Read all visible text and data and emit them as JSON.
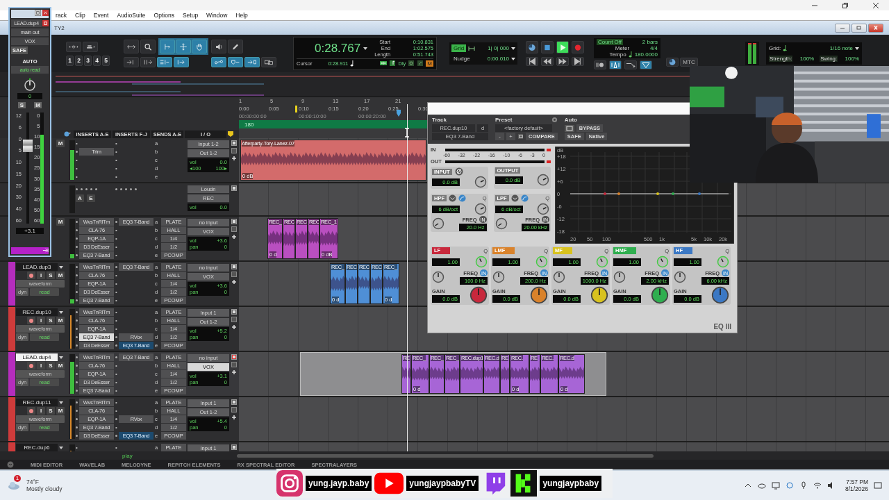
{
  "window": {
    "title_fragment": "TY2"
  },
  "menu": [
    "rack",
    "Clip",
    "Event",
    "AudioSuite",
    "Options",
    "Setup",
    "Window",
    "Help"
  ],
  "toolbar": {
    "zoom_presets": [
      "1",
      "2",
      "3",
      "4",
      "5"
    ],
    "counter": "0:28.767",
    "range_labels": [
      "Start",
      "End",
      "Length"
    ],
    "range_values": [
      "0:10.831",
      "1:02.575",
      "0:51.743"
    ],
    "cursor_label": "Cursor",
    "cursor_value": "0:28.911",
    "dly": "Dly",
    "m": "M",
    "grid_label": "Grid",
    "nudge_label": "Nudge",
    "grid_value": "1| 0| 000",
    "nudge_value": "0:00.010",
    "playing": true,
    "count_off": "Count Off",
    "bars": "2 bars",
    "meter_label": "Meter",
    "meter": "4/4",
    "tempo_label": "Tempo",
    "tempo": "180.0000",
    "mtc": "MTC",
    "grid2_label": "Grid:",
    "grid2_value": "1/16 note",
    "strength_label": "Strength:",
    "strength": "100%",
    "swing_label": "Swing:",
    "swing": "100%"
  },
  "ruler": {
    "bars": [
      "1",
      "5",
      "9",
      "13",
      "17",
      "21"
    ],
    "times": [
      "0:00",
      "0:05",
      "0:10",
      "0:15",
      "0:20",
      "0:25",
      "0:30"
    ],
    "timecodes": [
      "00:00:00:00",
      "00:00:10:00",
      "00:00:20:00"
    ],
    "tempo": "180"
  },
  "columns": [
    "INSERTS A-E",
    "INSERTS F-J",
    "SENDS A-E",
    "I / O"
  ],
  "tracks": [
    {
      "kind": "audio",
      "buttons": [
        "M"
      ],
      "level": 0.75,
      "inserts_a": [
        {
          "kind": "empty",
          "mark": "•"
        },
        {
          "kind": "plugin",
          "name": "Trim"
        },
        {
          "kind": "empty",
          "mark": "•"
        },
        {
          "kind": "empty",
          "mark": "•"
        },
        {
          "kind": "empty",
          "mark": "•"
        }
      ],
      "inserts_f": [
        {
          "kind": "empty",
          "mark": "•"
        },
        {
          "kind": "empty",
          "mark": "•"
        },
        {
          "kind": "empty",
          "mark": "•"
        },
        {
          "kind": "empty",
          "mark": "•"
        },
        {
          "kind": "empty",
          "mark": "•"
        }
      ],
      "sends": [
        {
          "letter": "a"
        },
        {
          "letter": "b"
        },
        {
          "letter": "c"
        },
        {
          "letter": "d"
        },
        {
          "letter": "e"
        }
      ],
      "input": "Input 1-2",
      "output": "Out 1-2",
      "vol_label": "vol",
      "vol": "0.0",
      "pan_left": "◂100",
      "pan_right": "100▸",
      "clips": [
        {
          "label": "Afterparty-Tory-Lanez-07",
          "gain": "0 dB",
          "color": "#d36b6b"
        }
      ]
    },
    {
      "kind": "aux",
      "buttons": [
        "A",
        "E"
      ],
      "input": "Loudn",
      "output": "REC",
      "vol_label": "vol",
      "vol": "0.0"
    },
    {
      "kind": "audio",
      "buttons": [
        "M"
      ],
      "level": 0.1,
      "inserts_a": [
        {
          "kind": "plugin",
          "name": "WvsTnRlTm"
        },
        {
          "kind": "plugin",
          "name": "CLA-76"
        },
        {
          "kind": "plugin",
          "name": "EQP-1A"
        },
        {
          "kind": "plugin",
          "name": "D3 DeEsser"
        },
        {
          "kind": "plugin",
          "name": "EQ3 7-Band"
        }
      ],
      "inserts_f": [
        {
          "kind": "plugin",
          "name": "EQ3 7-Band"
        },
        {
          "kind": "empty",
          "mark": "•"
        },
        {
          "kind": "empty",
          "mark": "•"
        },
        {
          "kind": "empty",
          "mark": "•"
        },
        {
          "kind": "empty",
          "mark": "•"
        }
      ],
      "sends": [
        {
          "letter": "a",
          "name": "PLATE"
        },
        {
          "letter": "b",
          "name": "HALL"
        },
        {
          "letter": "c",
          "name": "1/4"
        },
        {
          "letter": "d",
          "name": "1/2"
        },
        {
          "letter": "e",
          "name": "PCOMP"
        }
      ],
      "input": "no input",
      "output": "VOX",
      "vol_label": "vol",
      "vol": "+3.6",
      "pan_label": "pan",
      "pan": "0",
      "clips": [
        {
          "label": "REC_",
          "gain": "0 d",
          "color": "#b94fc0"
        },
        {
          "label": "REC",
          "color": "#b94fc0"
        },
        {
          "label": "REC",
          "color": "#b94fc0"
        },
        {
          "label": "REC",
          "color": "#b94fc0"
        },
        {
          "label": "REC_1",
          "gain": "0 dB",
          "color": "#b94fc0"
        }
      ]
    },
    {
      "kind": "audio",
      "name": "LEAD.dup3",
      "color": "#b52dbd",
      "selected": false,
      "buttons": [
        "I",
        "S",
        "M"
      ],
      "armable": true,
      "view": "waveform",
      "dyn": "dyn",
      "auto": "read",
      "level": 0.1,
      "inserts_a": [
        {
          "kind": "plugin",
          "name": "WvsTnRlTm"
        },
        {
          "kind": "plugin",
          "name": "CLA-76"
        },
        {
          "kind": "plugin",
          "name": "EQP-1A"
        },
        {
          "kind": "plugin",
          "name": "D3 DeEsser"
        },
        {
          "kind": "plugin",
          "name": "EQ3 7-Band"
        }
      ],
      "inserts_f": [
        {
          "kind": "plugin",
          "name": "EQ3 7-Band"
        },
        {
          "kind": "empty",
          "mark": "•"
        },
        {
          "kind": "empty",
          "mark": "•"
        },
        {
          "kind": "empty",
          "mark": "•"
        },
        {
          "kind": "empty",
          "mark": "•"
        }
      ],
      "sends": [
        {
          "letter": "a",
          "name": "PLATE"
        },
        {
          "letter": "b",
          "name": "HALL"
        },
        {
          "letter": "c",
          "name": "1/4"
        },
        {
          "letter": "d",
          "name": "1/2"
        },
        {
          "letter": "e",
          "name": "PCOMP"
        }
      ],
      "input": "no input",
      "output": "VOX",
      "vol_label": "vol",
      "vol": "+3.6",
      "pan_label": "pan",
      "pan": "0",
      "clips": [
        {
          "label": "REC_",
          "gain": "0 d",
          "color": "#4f8fd6"
        },
        {
          "label": "REC",
          "color": "#4f8fd6"
        },
        {
          "label": "REC",
          "color": "#4f8fd6"
        },
        {
          "label": "REC",
          "color": "#4f8fd6"
        },
        {
          "label": "REC_",
          "gain": "0 d",
          "color": "#4f8fd6"
        }
      ]
    },
    {
      "kind": "audio",
      "name": "REC.dup10",
      "color": "#cf3b3b",
      "selected": false,
      "buttons": [
        "I",
        "S",
        "M"
      ],
      "armable": true,
      "view": "waveform",
      "dyn": "dyn",
      "auto": "read",
      "level": 0.85,
      "inserts_a": [
        {
          "kind": "plugin",
          "name": "WvsTnRlTm"
        },
        {
          "kind": "plugin",
          "name": "CLA-76"
        },
        {
          "kind": "plugin",
          "name": "EQP-1A"
        },
        {
          "kind": "open",
          "name": "EQ3 7-Band"
        },
        {
          "kind": "plugin",
          "name": "D3 DeEsser"
        }
      ],
      "inserts_f": [
        {
          "kind": "empty",
          "mark": "•"
        },
        {
          "kind": "empty",
          "mark": "•"
        },
        {
          "kind": "empty",
          "mark": "•"
        },
        {
          "kind": "plugin",
          "name": "RVox"
        },
        {
          "kind": "active",
          "name": "EQ3 7-Band"
        }
      ],
      "sends": [
        {
          "letter": "a",
          "name": "PLATE"
        },
        {
          "letter": "b",
          "name": "HALL"
        },
        {
          "letter": "c",
          "name": "1/4"
        },
        {
          "letter": "d",
          "name": "1/2"
        },
        {
          "letter": "e",
          "name": "PCOMP"
        }
      ],
      "input": "Input 1",
      "output": "Out 1-2",
      "vol_label": "vol",
      "vol": "+5.2",
      "pan_label": "pan",
      "pan": "0"
    },
    {
      "kind": "audio",
      "name": "LEAD.dup4",
      "color": "#b52dbd",
      "selected": true,
      "buttons": [
        "I",
        "S",
        "M"
      ],
      "armable": true,
      "view": "waveform",
      "dyn": "dyn",
      "auto": "read",
      "level": 0.8,
      "inserts_a": [
        {
          "kind": "plugin",
          "name": "WvsTnRlTm"
        },
        {
          "kind": "plugin",
          "name": "CLA-76"
        },
        {
          "kind": "plugin",
          "name": "EQP-1A"
        },
        {
          "kind": "plugin",
          "name": "D3 DeEsser"
        },
        {
          "kind": "plugin",
          "name": "EQ3 7-Band"
        }
      ],
      "inserts_f": [
        {
          "kind": "plugin",
          "name": "EQ3 7-Band"
        },
        {
          "kind": "empty",
          "mark": "•"
        },
        {
          "kind": "empty",
          "mark": "•"
        },
        {
          "kind": "empty",
          "mark": "•"
        },
        {
          "kind": "empty",
          "mark": "•"
        }
      ],
      "sends": [
        {
          "letter": "a",
          "name": "PLATE"
        },
        {
          "letter": "b",
          "name": "HALL"
        },
        {
          "letter": "c",
          "name": "1/4"
        },
        {
          "letter": "d",
          "name": "1/2"
        },
        {
          "letter": "e",
          "name": "PCOMP"
        }
      ],
      "input": "no input",
      "output": "VOX",
      "vol_label": "vol",
      "vol": "+3.1",
      "pan_label": "pan",
      "pan": "0",
      "selection": true,
      "clips": [
        {
          "label": "RE",
          "color": "#a765d6"
        },
        {
          "label": "REC_",
          "gain": "0 d",
          "color": "#a765d6"
        },
        {
          "label": "REC_",
          "color": "#a765d6"
        },
        {
          "label": "REC_",
          "color": "#a765d6"
        },
        {
          "label": "REC.dup1",
          "color": "#a765d6"
        },
        {
          "label": "REC.d",
          "color": "#a765d6"
        },
        {
          "label": "RE",
          "color": "#a765d6"
        },
        {
          "label": "REC.",
          "gain": "0 d",
          "color": "#a765d6"
        },
        {
          "label": "RE",
          "color": "#a765d6"
        },
        {
          "label": "REC.",
          "color": "#a765d6"
        },
        {
          "label": "REC.d",
          "gain": "0 d",
          "color": "#a765d6"
        }
      ]
    },
    {
      "kind": "audio",
      "name": "REC.dup11",
      "color": "#cf3b3b",
      "selected": false,
      "buttons": [
        "I",
        "S",
        "M"
      ],
      "armable": true,
      "view": "waveform",
      "dyn": "dyn",
      "auto": "read",
      "level": 0.85,
      "inserts_a": [
        {
          "kind": "plugin",
          "name": "WvsTnRlTm"
        },
        {
          "kind": "plugin",
          "name": "CLA-76"
        },
        {
          "kind": "plugin",
          "name": "EQP-1A"
        },
        {
          "kind": "plugin",
          "name": "EQ3 7-Band"
        },
        {
          "kind": "plugin",
          "name": "D3 DeEsser"
        }
      ],
      "inserts_f": [
        {
          "kind": "empty",
          "mark": "•"
        },
        {
          "kind": "empty",
          "mark": "•"
        },
        {
          "kind": "plugin",
          "name": "RVox"
        },
        {
          "kind": "empty",
          "mark": "•"
        },
        {
          "kind": "active",
          "name": "EQ3 7-Band"
        }
      ],
      "sends": [
        {
          "letter": "a",
          "name": "PLATE"
        },
        {
          "letter": "b",
          "name": "HALL"
        },
        {
          "letter": "c",
          "name": "1/4"
        },
        {
          "letter": "d",
          "name": "1/2"
        },
        {
          "letter": "e",
          "name": "PCOMP"
        }
      ],
      "input": "Input 1",
      "output": "Out 1-2",
      "vol_label": "vol",
      "vol": "+5.4",
      "pan_label": "pan",
      "pan": "0"
    },
    {
      "kind": "audio",
      "name": "REC.dup6",
      "color": "#cf3b3b",
      "selected": false,
      "level": 0.85,
      "inserts_a": [
        {
          "kind": "empty",
          "mark": "•"
        }
      ],
      "inserts_f": [
        {
          "kind": "empty",
          "mark": "•"
        }
      ],
      "sends": [
        {
          "letter": "a",
          "name": "PLATE"
        }
      ],
      "input": "Input 1"
    }
  ],
  "footer": {
    "mode": "play",
    "tabs": [
      "MIDI EDITOR",
      "WAVELAB",
      "MELODYNE",
      "REPITCH ELEMENTS",
      "RX SPECTRAL EDITOR",
      "SPECTRALAYERS"
    ]
  },
  "strip": {
    "name": "LEAD.dup4",
    "output": "main out",
    "group": "VOX",
    "safe": "SAFE",
    "auto_label": "AUTO",
    "auto": "auto read",
    "pan": "0",
    "solo": "S",
    "mute": "M",
    "scale": [
      "12",
      "6",
      "0",
      "5",
      "10",
      "15",
      "20",
      "30",
      "40",
      "60"
    ],
    "meter_scale": [
      "0",
      "5",
      "10",
      "15",
      "20",
      "25",
      "30",
      "35",
      "40",
      "50",
      "60"
    ],
    "level": 0.7,
    "meter": {
      "level": 0.8
    },
    "volume": "+3.1"
  },
  "plugin": {
    "track_label": "Track",
    "preset_label": "Preset",
    "auto_label": "Auto",
    "track": "REC.dup10",
    "channel": "d",
    "preset": "<factory default>",
    "plugin": "EQ3 7-Band",
    "minus": "-",
    "plus": "+",
    "compare": "COMPARE",
    "safe": "SAFE",
    "bypass": "BYPASS",
    "native": "Native",
    "in": "IN",
    "out": "OUT",
    "meter_scale": [
      "-60",
      "-32",
      "-22",
      "-16",
      "-10",
      "-6",
      "-3",
      "0"
    ],
    "gains": [
      {
        "label": "INPUT",
        "value": "0.0 dB"
      },
      {
        "label": "OUTPUT",
        "value": "0.0 dB"
      }
    ],
    "filters": [
      {
        "label": "HPF",
        "q_label": "Q",
        "slope": "6 dB/oct",
        "freq_label": "FREQ",
        "freq": "20.0 Hz",
        "in": "IN"
      },
      {
        "label": "LPF",
        "q_label": "Q",
        "slope": "6 dB/oct",
        "freq_label": "FREQ",
        "freq": "20.00 kHz",
        "in": "IN"
      }
    ],
    "graph": {
      "unit": "dB",
      "y_labels": [
        "+18",
        "+12",
        "+6",
        "0",
        "-6",
        "-12",
        "-18"
      ],
      "x_labels": [
        "20",
        "50",
        "100",
        "500",
        "1k",
        "5k",
        "10k",
        "20k"
      ]
    },
    "bands": [
      {
        "label": "LF",
        "color": "#c8283c",
        "q_label": "Q",
        "q": "1.00",
        "freq_label": "FREQ",
        "freq": "100.0 Hz",
        "gain_label": "GAIN",
        "gain": "0.0 dB",
        "in": "IN"
      },
      {
        "label": "LMF",
        "color": "#d9822b",
        "q_label": "Q",
        "q": "1.00",
        "freq_label": "FREQ",
        "freq": "200.0 Hz",
        "gain_label": "GAIN",
        "gain": "0.0 dB",
        "in": "IN"
      },
      {
        "label": "MF",
        "color": "#d8c21f",
        "q_label": "Q",
        "q": "1.00",
        "freq_label": "FREQ",
        "freq": "1000.0 Hz",
        "gain_label": "GAIN",
        "gain": "0.0 dB",
        "in": "IN"
      },
      {
        "label": "HMF",
        "color": "#2fae4f",
        "q_label": "Q",
        "q": "1.00",
        "freq_label": "FREQ",
        "freq": "2.00 kHz",
        "gain_label": "GAIN",
        "gain": "0.0 dB",
        "in": "IN"
      },
      {
        "label": "HF",
        "color": "#3b78c4",
        "q_label": "Q",
        "q": "1.00",
        "freq_label": "FREQ",
        "freq": "6.00 kHz",
        "gain_label": "GAIN",
        "gain": "0.0 dB",
        "in": "IN"
      }
    ],
    "logo": "EQ III"
  },
  "banner": [
    {
      "kind": "instagram",
      "handle": "yung.jayp.baby"
    },
    {
      "kind": "youtube",
      "handle": "yungjaypbabyTV"
    },
    {
      "kind": "twitch"
    },
    {
      "kind": "kick",
      "handle": "yungjaypbaby"
    }
  ],
  "taskbar": {
    "badge": "1",
    "temp": "74°F",
    "weather": "Mostly cloudy",
    "time": "7:57 PM",
    "date": "8/1/2026"
  }
}
